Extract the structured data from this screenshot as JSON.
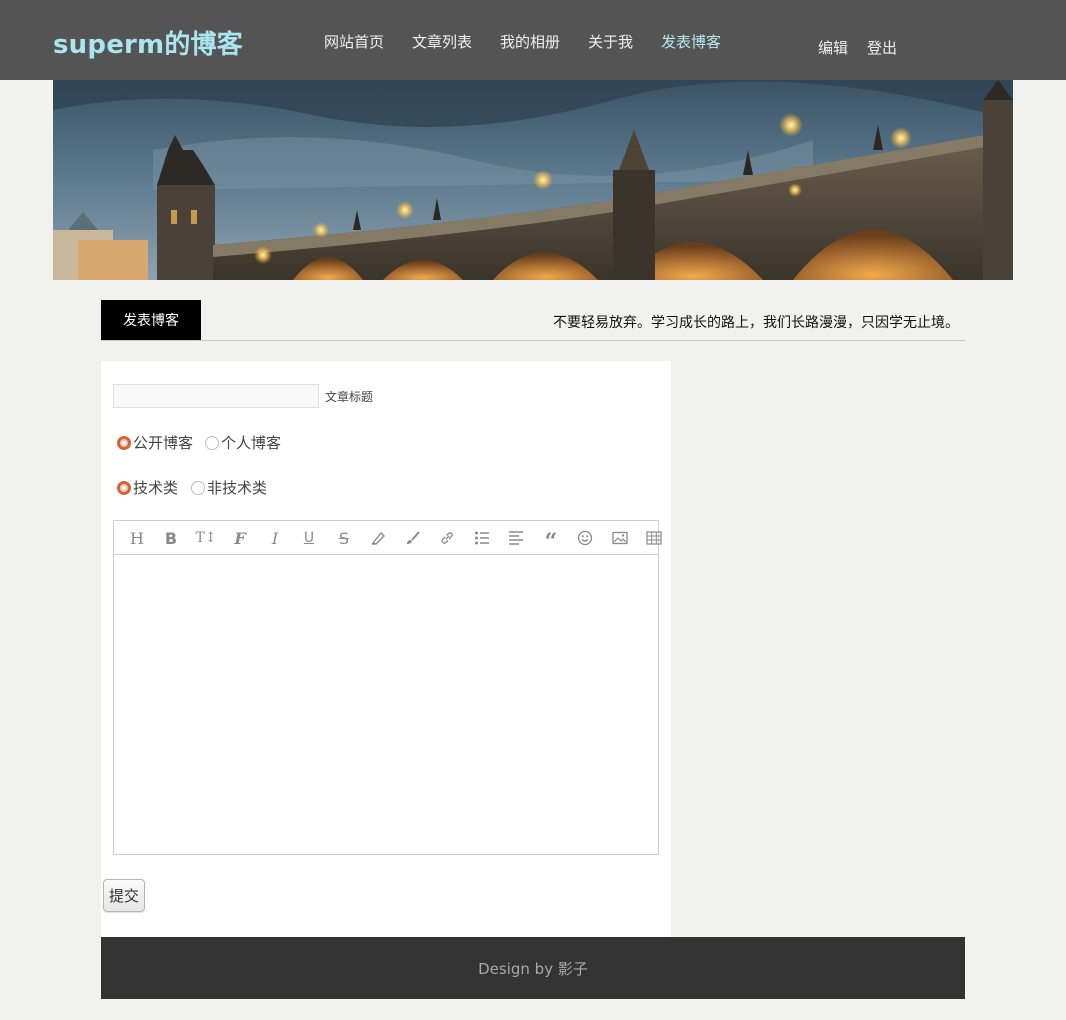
{
  "header": {
    "brand": "superm的博客",
    "nav": [
      "网站首页",
      "文章列表",
      "我的相册",
      "关于我",
      "发表博客"
    ],
    "user_links": [
      "编辑",
      "登出"
    ],
    "colors": {
      "bar": "#545454",
      "brand": "#a9e6ef",
      "active": "#b6eaf1"
    }
  },
  "section": {
    "tab_label": "发表博客",
    "motto": "不要轻易放弃。学习成长的路上，我们长路漫漫，只因学无止境。"
  },
  "form": {
    "title_value": "",
    "title_label": "文章标题",
    "visibility": {
      "options": [
        "公开博客",
        "个人博客"
      ],
      "selected": "公开博客"
    },
    "category": {
      "options": [
        "技术类",
        "非技术类"
      ],
      "selected": "技术类"
    },
    "editor_content": "",
    "toolbar_icons": [
      "heading-icon",
      "bold-icon",
      "text-size-icon",
      "font-icon",
      "italic-icon",
      "underline-icon",
      "strikethrough-icon",
      "highlighter-icon",
      "brush-icon",
      "link-icon",
      "list-icon",
      "align-icon",
      "quote-icon",
      "emoji-icon",
      "image-icon",
      "table-icon"
    ],
    "submit_label": "提交"
  },
  "footer": {
    "text": "Design by 影子"
  }
}
